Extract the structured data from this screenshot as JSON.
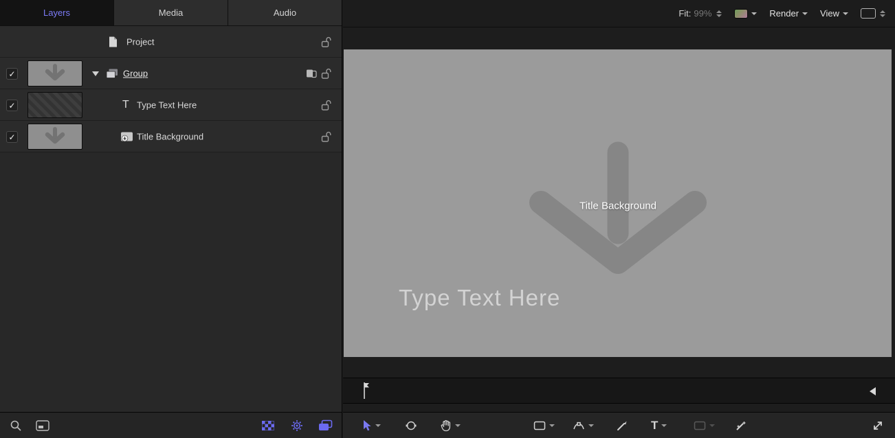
{
  "colors": {
    "accent": "#6b6af0",
    "canvas_bg": "#9b9b9b",
    "arrow": "#868686"
  },
  "tabs": [
    {
      "label": "Layers",
      "active": true
    },
    {
      "label": "Media",
      "active": false
    },
    {
      "label": "Audio",
      "active": false
    }
  ],
  "layers_panel": {
    "project_label": "Project",
    "group_row": {
      "label": "Group",
      "checked": true
    },
    "text_row": {
      "label": "Type Text Here",
      "checked": true
    },
    "background_row": {
      "label": "Title Background",
      "checked": true
    }
  },
  "viewer_toolbar": {
    "fit_label": "Fit:",
    "zoom_value": "99%",
    "render_label": "Render",
    "view_label": "View"
  },
  "canvas": {
    "title_overlay": "Title Background",
    "placeholder_text": "Type Text Here"
  },
  "glyphs": {
    "check": "✓",
    "text_layer": "T",
    "text_tool": "T"
  }
}
